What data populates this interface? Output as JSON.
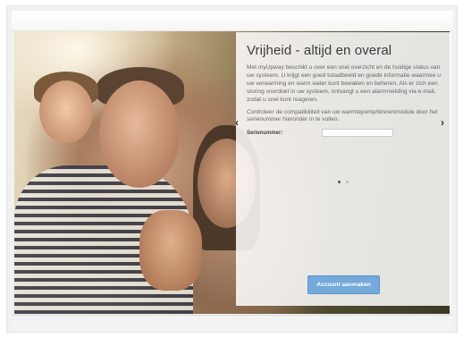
{
  "hero": {
    "title": "Vrijheid - altijd en overal",
    "paragraph1": "Met myUpway beschikt u over een snel overzicht en de huidige status van uw systeem. U krijgt een goed totaalbeeld en goede informatie waarmee u uw verwarming en warm water kunt bewaken en beheren. Als er zich een storing voordoet in uw systeem, ontvangt u een alarmmelding via e-mail, zodat u snel kunt reageren.",
    "paragraph2": "Controleer de compatibiliteit van uw warmtepomp/binnenmodule door het serienummer hieronder in te vullen.",
    "serial_label": "Serienummer:",
    "serial_value": "",
    "serial_placeholder": "",
    "create_account_label": "Account aanmaken",
    "prev_arrow": "‹",
    "next_arrow": "›",
    "slides": [
      {
        "active": true
      },
      {
        "active": false
      }
    ]
  }
}
